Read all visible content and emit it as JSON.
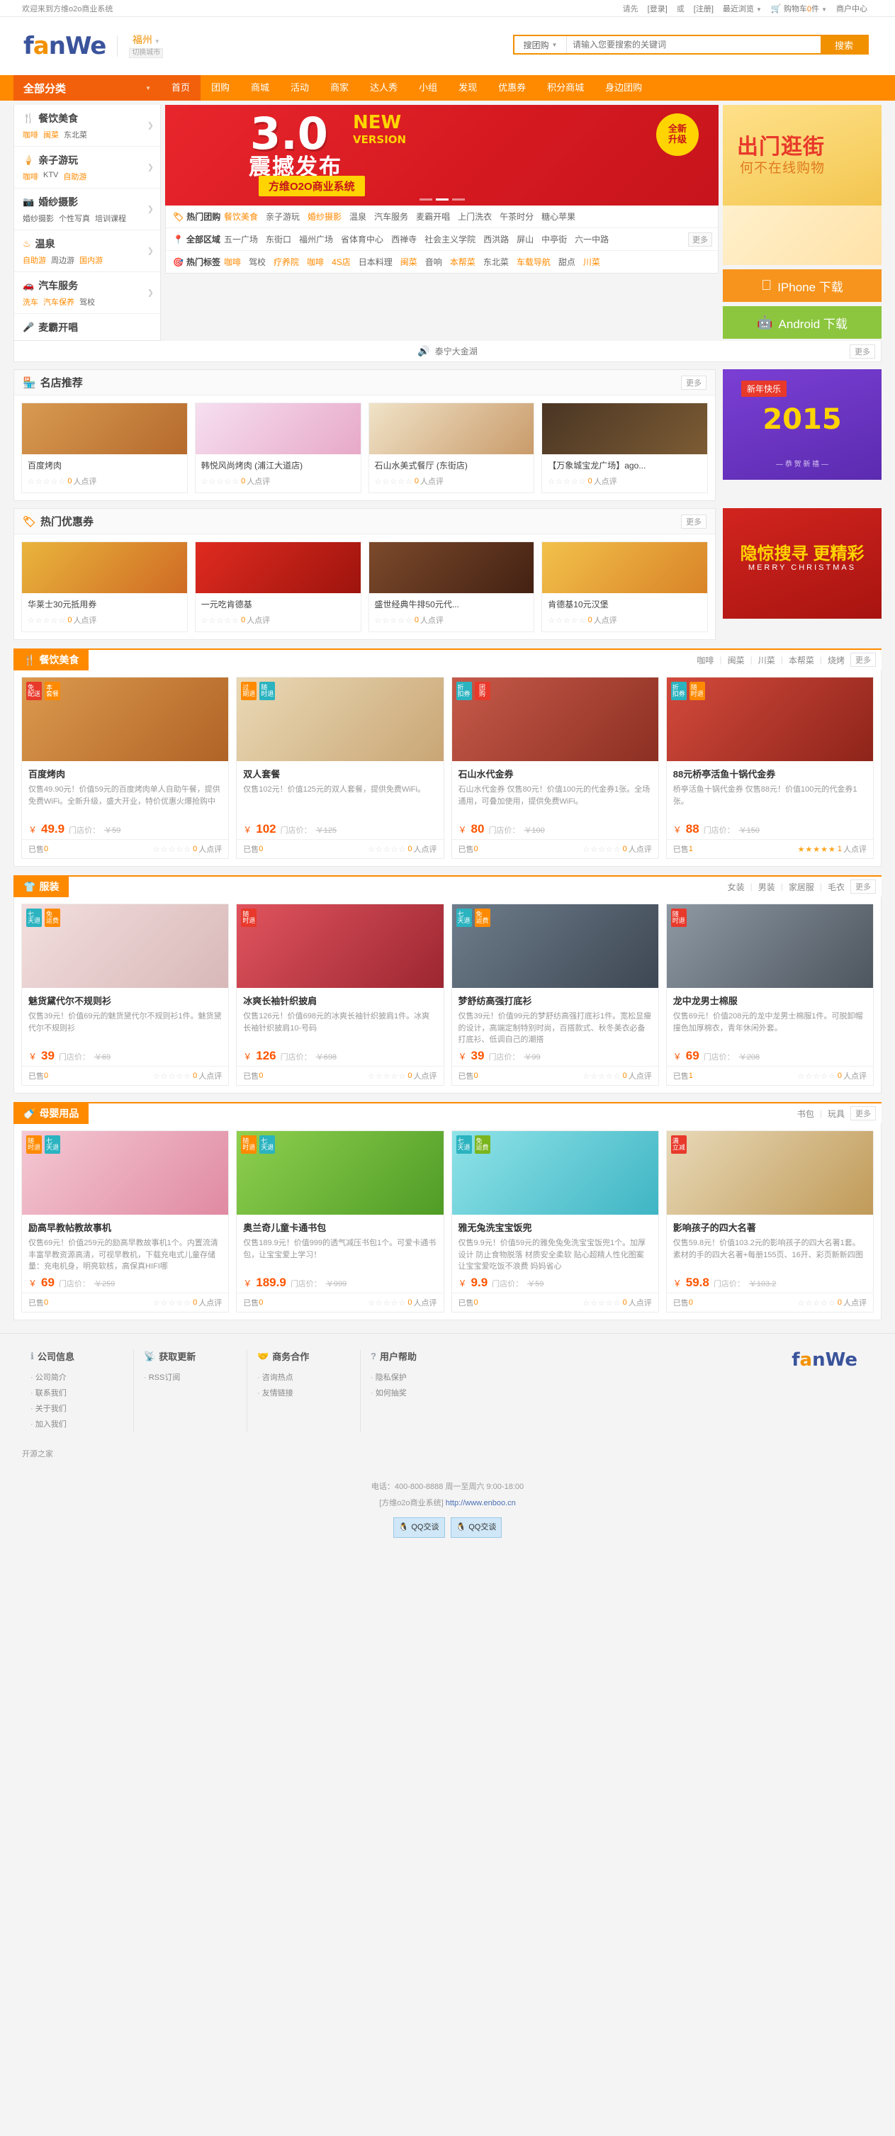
{
  "topbar": {
    "welcome": "欢迎来到方维o2o商业系统",
    "please": "请先",
    "login": "[登录]",
    "or": "或",
    "register": "[注册]",
    "recent": "最近浏览",
    "cart_icon": "cart-icon",
    "cart_label": "购物车",
    "cart_count": "0",
    "cart_unit": "件",
    "merchant": "商户中心"
  },
  "header": {
    "logo_a": "f",
    "logo_o": "a",
    "logo_b": "nWe",
    "city": "福州",
    "city_switch": "切换城市",
    "search": {
      "select": "搜团购",
      "placeholder": "请输入您要搜索的关键词",
      "button": "搜索",
      "hotwords": []
    }
  },
  "nav": {
    "all_categories": "全部分类",
    "items": [
      {
        "label": "首页",
        "active": true
      },
      {
        "label": "团购",
        "active": false
      },
      {
        "label": "商城",
        "active": false
      },
      {
        "label": "活动",
        "active": false
      },
      {
        "label": "商家",
        "active": false
      },
      {
        "label": "达人秀",
        "active": false
      },
      {
        "label": "小组",
        "active": false
      },
      {
        "label": "发现",
        "active": false
      },
      {
        "label": "优惠券",
        "active": false
      },
      {
        "label": "积分商城",
        "active": false
      },
      {
        "label": "身边团购",
        "active": false
      }
    ]
  },
  "sidecat": [
    {
      "icon": "cutlery-icon",
      "glyph": "🍴",
      "title": "餐饮美食",
      "subs": [
        {
          "t": "咖啡",
          "o": true
        },
        {
          "t": "闽菜",
          "o": true
        },
        {
          "t": "东北菜",
          "o": false
        }
      ]
    },
    {
      "icon": "icecream-icon",
      "glyph": "🍦",
      "title": "亲子游玩",
      "subs": [
        {
          "t": "咖啡",
          "o": true
        },
        {
          "t": "KTV",
          "o": false
        },
        {
          "t": "自助游",
          "o": true
        }
      ]
    },
    {
      "icon": "camera-icon",
      "glyph": "📷",
      "title": "婚纱摄影",
      "subs": [
        {
          "t": "婚纱摄影",
          "o": false
        },
        {
          "t": "个性写真",
          "o": false
        },
        {
          "t": "培训课程",
          "o": false
        }
      ]
    },
    {
      "icon": "hotspring-icon",
      "glyph": "♨",
      "title": "温泉",
      "subs": [
        {
          "t": "自助游",
          "o": true
        },
        {
          "t": "周边游",
          "o": false
        },
        {
          "t": "国内游",
          "o": true
        }
      ]
    },
    {
      "icon": "car-icon",
      "glyph": "🚗",
      "title": "汽车服务",
      "subs": [
        {
          "t": "洗车",
          "o": true
        },
        {
          "t": "汽车保养",
          "o": true
        },
        {
          "t": "驾校",
          "o": false
        }
      ]
    },
    {
      "icon": "mic-icon",
      "glyph": "🎤",
      "title": "麦霸开唱",
      "subs": []
    }
  ],
  "banner": {
    "version_num": "3.0",
    "new": "NEW",
    "version_word": "VERSION",
    "headline": "震撼发布",
    "ribbon": "方维O2O商业系统",
    "badge_line1": "全新",
    "badge_line2": "升级",
    "dots": 3,
    "active_dot": 1
  },
  "rightbanner": {
    "line1": "出门逛街",
    "line2": "何不在线购物"
  },
  "downloads": [
    {
      "icon": "apple-icon",
      "glyph": "",
      "label": "IPhone 下载",
      "color": "#f7941d"
    },
    {
      "icon": "android-icon",
      "glyph": "🤖",
      "label": "Android 下载",
      "color": "#8cc63e"
    }
  ],
  "quick": [
    {
      "icon": "tag-icon",
      "glyph": "🏷",
      "label": "热门团购",
      "items": [
        {
          "t": "餐饮美食",
          "o": true
        },
        {
          "t": "亲子游玩",
          "o": false
        },
        {
          "t": "婚纱摄影",
          "o": true
        },
        {
          "t": "温泉",
          "o": false
        },
        {
          "t": "汽车服务",
          "o": false
        },
        {
          "t": "麦霸开唱",
          "o": false
        },
        {
          "t": "上门洗衣",
          "o": false
        },
        {
          "t": "午茶时分",
          "o": false
        },
        {
          "t": "糖心苹果",
          "o": false
        }
      ],
      "more": null
    },
    {
      "icon": "location-icon",
      "glyph": "📍",
      "label": "全部区域",
      "items": [
        {
          "t": "五一广场",
          "o": false
        },
        {
          "t": "东街口",
          "o": false
        },
        {
          "t": "福州广场",
          "o": false
        },
        {
          "t": "省体育中心",
          "o": false
        },
        {
          "t": "西禅寺",
          "o": false
        },
        {
          "t": "社会主义学院",
          "o": false
        },
        {
          "t": "西洪路",
          "o": false
        },
        {
          "t": "屏山",
          "o": false
        },
        {
          "t": "中亭街",
          "o": false
        },
        {
          "t": "六一中路",
          "o": false
        }
      ],
      "more": "更多"
    },
    {
      "icon": "target-icon",
      "glyph": "🎯",
      "label": "热门标签",
      "items": [
        {
          "t": "咖啡",
          "o": true
        },
        {
          "t": "驾校",
          "o": false
        },
        {
          "t": "疗养院",
          "o": true
        },
        {
          "t": "咖啡",
          "o": true
        },
        {
          "t": "4S店",
          "o": true
        },
        {
          "t": "日本料理",
          "o": false
        },
        {
          "t": "闽菜",
          "o": true
        },
        {
          "t": "音响",
          "o": false
        },
        {
          "t": "本帮菜",
          "o": true
        },
        {
          "t": "东北菜",
          "o": false
        },
        {
          "t": "车载导航",
          "o": true
        },
        {
          "t": "甜点",
          "o": false
        },
        {
          "t": "川菜",
          "o": true
        }
      ],
      "more": null
    }
  ],
  "notice": {
    "icon": "speaker-icon",
    "text": "泰宁大金湖",
    "more": "更多"
  },
  "stores": {
    "icon": "shop-icon",
    "title": "名店推荐",
    "more": "更多",
    "items": [
      {
        "name": "百度烤肉",
        "stars": 0,
        "reviews": "0",
        "review_unit": "人点评",
        "img": "bbq"
      },
      {
        "name": "韩悦风尚烤肉 (浦江大道店)",
        "stars": 0,
        "reviews": "0",
        "review_unit": "人点评",
        "img": "korean"
      },
      {
        "name": "石山水美式餐厅 (东街店)",
        "stars": 0,
        "reviews": "0",
        "review_unit": "人点评",
        "img": "american"
      },
      {
        "name": "【万象城宝龙广场】ago...",
        "stars": 0,
        "reviews": "0",
        "review_unit": "人点评",
        "img": "mall"
      }
    ]
  },
  "sidead1": {
    "tag": "新年快乐",
    "year": "2015",
    "sub": "— 恭  贺  新  禧 —"
  },
  "sidead2": {
    "line1": "隐惊搜寻 更精彩",
    "line2": "MERRY CHRISTMAS"
  },
  "coupons": {
    "icon": "coupon-icon",
    "title": "热门优惠券",
    "more": "更多",
    "items": [
      {
        "name": "华莱士30元抵用券",
        "stars": 0,
        "reviews": "0",
        "review_unit": "人点评",
        "img": "burger"
      },
      {
        "name": "一元吃肯德基",
        "stars": 0,
        "reviews": "0",
        "review_unit": "人点评",
        "img": "kfc"
      },
      {
        "name": "盛世经典牛排50元代...",
        "stars": 0,
        "reviews": "0",
        "review_unit": "人点评",
        "img": "steak"
      },
      {
        "name": "肯德基10元汉堡",
        "stars": 0,
        "reviews": "0",
        "review_unit": "人点评",
        "img": "burger2"
      }
    ]
  },
  "sections": [
    {
      "icon": "cutlery-icon",
      "glyph": "🍴",
      "title": "餐饮美食",
      "tags": [
        "咖啡",
        "闽菜",
        "川菜",
        "本帮菜",
        "烧烤"
      ],
      "more": "更多",
      "products": [
        {
          "name": "百度烤肉",
          "desc": "仅售49.90元！价值59元的百度烤肉单人自助午餐，提供免费WiFi。全新升级，盛大开业，特价优惠火爆抢购中",
          "cur": "￥",
          "price": "49.9",
          "old_label": "门店价：",
          "old": "￥59",
          "sold_label": "已售",
          "sold": "0",
          "stars": 0,
          "reviews": "0",
          "review_unit": "人点评",
          "flags": [
            {
              "t": "免\n配送",
              "c": "red"
            },
            {
              "t": "本\n套餐",
              "c": "org"
            }
          ],
          "img": "food1"
        },
        {
          "name": "双人套餐",
          "desc": "仅售102元！价值125元的双人套餐，提供免费WiFi。",
          "cur": "￥",
          "price": "102",
          "old_label": "门店价：",
          "old": "￥125",
          "sold_label": "已售",
          "sold": "0",
          "stars": 0,
          "reviews": "0",
          "review_unit": "人点评",
          "flags": [
            {
              "t": "过\n期退",
              "c": "org"
            },
            {
              "t": "随\n时退",
              "c": "cyan"
            }
          ],
          "img": "food2"
        },
        {
          "name": "石山水代金券",
          "desc": "石山水代金券 仅售80元！价值100元的代金券1张。全场通用，可叠加使用，提供免费WiFi。",
          "cur": "￥",
          "price": "80",
          "old_label": "门店价：",
          "old": "￥100",
          "sold_label": "已售",
          "sold": "0",
          "stars": 0,
          "reviews": "0",
          "review_unit": "人点评",
          "flags": [
            {
              "t": "折\n扣券",
              "c": "cyan"
            },
            {
              "t": "团\n购",
              "c": "red"
            }
          ],
          "img": "food3"
        },
        {
          "name": "88元桥亭活鱼十锅代金券",
          "desc": "桥亭活鱼十锅代金券 仅售88元！价值100元的代金券1张。",
          "cur": "￥",
          "price": "88",
          "old_label": "门店价：",
          "old": "￥150",
          "sold_label": "已售",
          "sold": "1",
          "stars": 5,
          "reviews": "1",
          "review_unit": "人点评",
          "flags": [
            {
              "t": "折\n扣券",
              "c": "cyan"
            },
            {
              "t": "随\n时退",
              "c": "org"
            }
          ],
          "img": "food4"
        }
      ]
    },
    {
      "icon": "shirt-icon",
      "glyph": "👕",
      "title": "服装",
      "tags": [
        "女装",
        "男装",
        "家居服",
        "毛衣"
      ],
      "more": "更多",
      "products": [
        {
          "name": "魅货黛代尔不规则衫",
          "desc": "仅售39元！价值69元的魅货黛代尔不规则衫1件。魅货黛代尔不规则衫",
          "cur": "￥",
          "price": "39",
          "old_label": "门店价：",
          "old": "￥69",
          "sold_label": "已售",
          "sold": "0",
          "stars": 0,
          "reviews": "0",
          "review_unit": "人点评",
          "flags": [
            {
              "t": "七\n天退",
              "c": "cyan"
            },
            {
              "t": "免\n运费",
              "c": "org"
            }
          ],
          "img": "cloth1"
        },
        {
          "name": "冰爽长袖针织披肩",
          "desc": "仅售126元！价值698元的冰爽长袖针织披肩1件。冰爽长袖针织披肩10-号码",
          "cur": "￥",
          "price": "126",
          "old_label": "门店价：",
          "old": "￥698",
          "sold_label": "已售",
          "sold": "0",
          "stars": 0,
          "reviews": "0",
          "review_unit": "人点评",
          "flags": [
            {
              "t": "随\n时退",
              "c": "red"
            }
          ],
          "img": "cloth2"
        },
        {
          "name": "梦舒纺高强打底衫",
          "desc": "仅售39元！价值99元的梦舒纺高强打底衫1件。宽松显瘦的设计，高端定制特别时尚，百搭款式、秋冬美衣必备打底衫、低调自己的潮搭",
          "cur": "￥",
          "price": "39",
          "old_label": "门店价：",
          "old": "￥99",
          "sold_label": "已售",
          "sold": "0",
          "stars": 0,
          "reviews": "0",
          "review_unit": "人点评",
          "flags": [
            {
              "t": "七\n天退",
              "c": "cyan"
            },
            {
              "t": "免\n运费",
              "c": "org"
            }
          ],
          "img": "cloth3"
        },
        {
          "name": "龙中龙男士棉服",
          "desc": "仅售69元！价值208元的龙中龙男士棉服1件。可脱卸帽撞色加厚棉衣，青年休闲外套。",
          "cur": "￥",
          "price": "69",
          "old_label": "门店价：",
          "old": "￥208",
          "sold_label": "已售",
          "sold": "1",
          "stars": 0,
          "reviews": "0",
          "review_unit": "人点评",
          "flags": [
            {
              "t": "随\n时退",
              "c": "red"
            }
          ],
          "img": "cloth4"
        }
      ]
    },
    {
      "icon": "baby-icon",
      "glyph": "🍼",
      "title": "母婴用品",
      "tags": [
        "书包",
        "玩具"
      ],
      "more": "更多",
      "products": [
        {
          "name": "励高早教帖教故事机",
          "desc": "仅售69元！价值259元的励高早教故事机1个。内置流清丰富早教资源高清，可视早教机，下载充电式儿童存储量：充电机身，明亮软核，高保真HIFI哪",
          "cur": "￥",
          "price": "69",
          "old_label": "门店价：",
          "old": "￥259",
          "sold_label": "已售",
          "sold": "0",
          "stars": 0,
          "reviews": "0",
          "review_unit": "人点评",
          "flags": [
            {
              "t": "随\n时退",
              "c": "org"
            },
            {
              "t": "七\n天退",
              "c": "cyan"
            }
          ],
          "img": "baby1"
        },
        {
          "name": "奥兰奇儿童卡通书包",
          "desc": "仅售189.9元！价值999的透气减压书包1个。可爱卡通书包，让宝宝爱上学习！",
          "cur": "￥",
          "price": "189.9",
          "old_label": "门店价：",
          "old": "￥999",
          "sold_label": "已售",
          "sold": "0",
          "stars": 0,
          "reviews": "0",
          "review_unit": "人点评",
          "flags": [
            {
              "t": "随\n时退",
              "c": "org"
            },
            {
              "t": "七\n天退",
              "c": "cyan"
            }
          ],
          "img": "baby2"
        },
        {
          "name": "雅无兔洗宝宝饭兜",
          "desc": "仅售9.9元！价值59元的雅免兔免洗宝宝饭兜1个。加厚设计 防止食物脱落 材质安全柔软 贴心超精人性化图案 让宝宝爱吃饭不浪费 妈妈省心",
          "cur": "￥",
          "price": "9.9",
          "old_label": "门店价：",
          "old": "￥59",
          "sold_label": "已售",
          "sold": "0",
          "stars": 0,
          "reviews": "0",
          "review_unit": "人点评",
          "flags": [
            {
              "t": "七\n天退",
              "c": "cyan"
            },
            {
              "t": "免\n运费",
              "c": "grn"
            }
          ],
          "img": "baby3"
        },
        {
          "name": "影响孩子的四大名著",
          "desc": "仅售59.8元！价值103.2元的影响孩子的四大名著1套。素材的手的四大名著+每册155页、16开、彩页新新四图",
          "cur": "￥",
          "price": "59.8",
          "old_label": "门店价：",
          "old": "￥103.2",
          "sold_label": "已售",
          "sold": "0",
          "stars": 0,
          "reviews": "0",
          "review_unit": "人点评",
          "flags": [
            {
              "t": "满\n立减",
              "c": "red"
            }
          ],
          "img": "baby4"
        }
      ]
    }
  ],
  "footer": {
    "cols": [
      {
        "icon": "info-icon",
        "glyph": "ℹ",
        "title": "公司信息",
        "links": [
          "公司简介",
          "联系我们",
          "关于我们",
          "加入我们"
        ]
      },
      {
        "icon": "rss-icon",
        "glyph": "📡",
        "title": "获取更新",
        "links": [
          "RSS订阅"
        ]
      },
      {
        "icon": "handshake-icon",
        "glyph": "🤝",
        "title": "商务合作",
        "links": [
          "咨询热点",
          "友情链接"
        ]
      },
      {
        "icon": "help-icon",
        "glyph": "?",
        "title": "用户帮助",
        "links": [
          "隐私保护",
          "如何抽奖"
        ]
      }
    ],
    "logo_a": "f",
    "logo_o": "a",
    "logo_b": "nWe",
    "friend_label": "开源之家",
    "phone": "电话：400-800-8888 周一至周六 9:00-18:00",
    "system": "[方维o2o商业系统]",
    "url": "http://www.enboo.cn",
    "qq": [
      {
        "label": "QQ交谈"
      },
      {
        "label": "QQ交谈"
      }
    ]
  }
}
